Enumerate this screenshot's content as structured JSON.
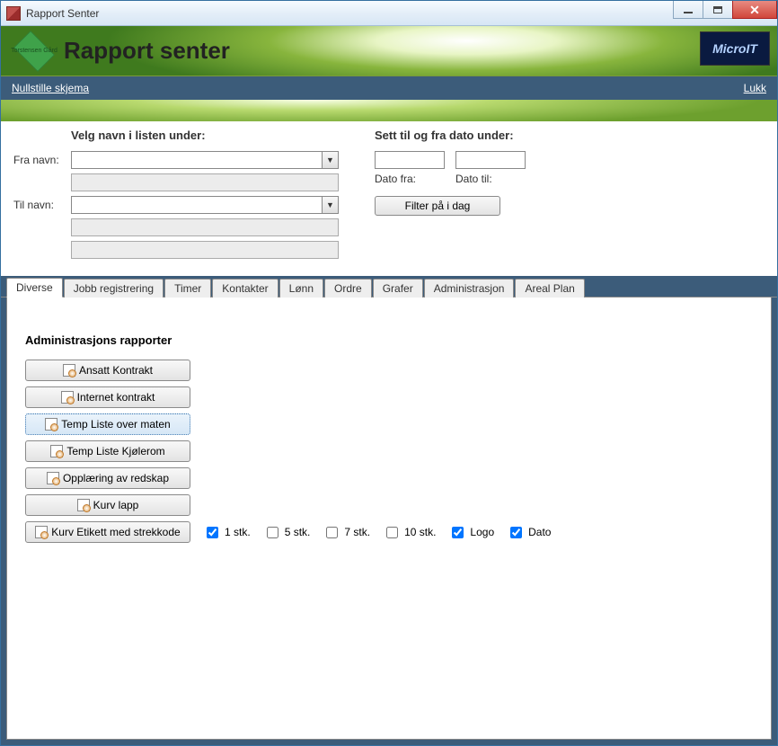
{
  "window": {
    "title": "Rapport Senter"
  },
  "banner": {
    "logo_text": "Torstensen Gård",
    "heading": "Rapport senter",
    "brand": "MicroIT"
  },
  "toolbar": {
    "reset": "Nullstille skjema",
    "close": "Lukk"
  },
  "form": {
    "left_heading": "Velg navn i listen under:",
    "fra_label": "Fra navn:",
    "til_label": "Til navn:",
    "right_heading": "Sett til og fra dato under:",
    "dato_fra": "Dato fra:",
    "dato_til": "Dato til:",
    "filter_btn": "Filter på i dag"
  },
  "tabs": [
    "Diverse",
    "Jobb registrering",
    "Timer",
    "Kontakter",
    "Lønn",
    "Ordre",
    "Grafer",
    "Administrasjon",
    "Areal Plan"
  ],
  "active_tab": "Diverse",
  "reports": {
    "heading": "Administrasjons rapporter",
    "buttons": [
      "Ansatt Kontrakt",
      "Internet kontrakt",
      "Temp Liste over maten",
      "Temp Liste Kjølerom",
      "Opplæring av redskap",
      "Kurv lapp",
      "Kurv Etikett med strekkode"
    ],
    "selected_index": 2,
    "checks": [
      {
        "label": "1 stk.",
        "checked": true
      },
      {
        "label": "5 stk.",
        "checked": false
      },
      {
        "label": "7 stk.",
        "checked": false
      },
      {
        "label": "10 stk.",
        "checked": false
      },
      {
        "label": "Logo",
        "checked": true
      },
      {
        "label": "Dato",
        "checked": true
      }
    ]
  }
}
